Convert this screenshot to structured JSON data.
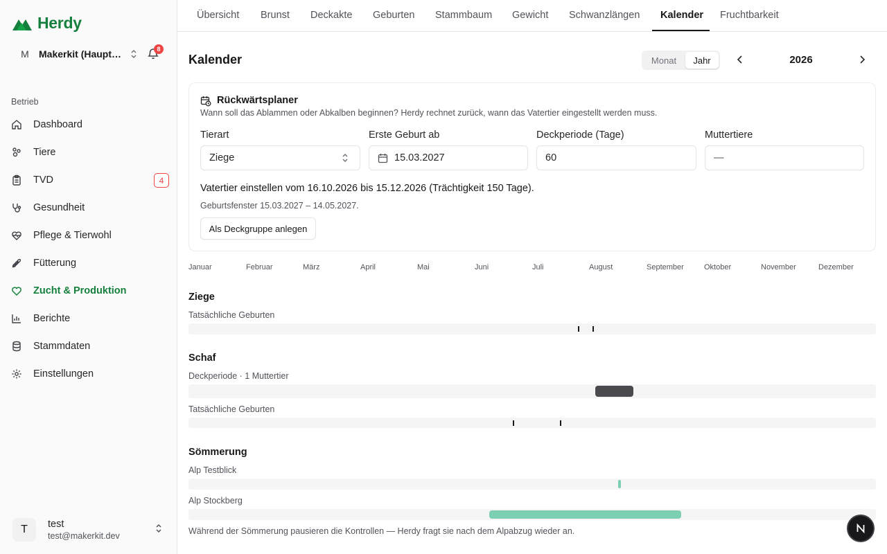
{
  "app": {
    "name": "Herdy",
    "brand_color": "#15803d"
  },
  "org": {
    "initial": "M",
    "name": "Makerkit (Hauptbetrieb)",
    "notifications": "8"
  },
  "sidebar": {
    "group_label": "Betrieb",
    "items": [
      {
        "label": "Dashboard",
        "icon": "home-icon"
      },
      {
        "label": "Tiere",
        "icon": "animal-icon"
      },
      {
        "label": "TVD",
        "icon": "clipboard-icon",
        "badge": "4"
      },
      {
        "label": "Gesundheit",
        "icon": "stethoscope-icon"
      },
      {
        "label": "Pflege & Tierwohl",
        "icon": "heart-pulse-icon"
      },
      {
        "label": "Fütterung",
        "icon": "wheat-icon"
      },
      {
        "label": "Zucht & Produktion",
        "icon": "heart-icon",
        "active": true
      },
      {
        "label": "Berichte",
        "icon": "bar-chart-icon"
      },
      {
        "label": "Stammdaten",
        "icon": "database-icon"
      },
      {
        "label": "Einstellungen",
        "icon": "gear-icon"
      }
    ]
  },
  "user": {
    "initial": "T",
    "name": "test",
    "email": "test@makerkit.dev"
  },
  "tabs": [
    "Übersicht",
    "Brunst",
    "Deckakte",
    "Geburten",
    "Stammbaum",
    "Gewicht",
    "Schwanzlängen",
    "Kalender",
    "Fruchtbarkeit"
  ],
  "active_tab": "Kalender",
  "header": {
    "title": "Kalender",
    "view_month": "Monat",
    "view_year": "Jahr",
    "active_view": "Jahr",
    "year": "2026"
  },
  "planner": {
    "title": "Rückwärtsplaner",
    "subtitle": "Wann soll das Ablammen oder Abkalben beginnen? Herdy rechnet zurück, wann das Vatertier eingestellt werden muss.",
    "fields": {
      "species_label": "Tierart",
      "species_value": "Ziege",
      "first_birth_label": "Erste Geburt ab",
      "first_birth_value": "15.03.2027",
      "period_label": "Deckperiode (Tage)",
      "period_value": "60",
      "mothers_label": "Muttertiere",
      "mothers_value": "—"
    },
    "result": "Vatertier einstellen vom 16.10.2026 bis 15.12.2026 (Trächtigkeit 150 Tage).",
    "window": "Geburtsfenster 15.03.2027 – 14.05.2027.",
    "button": "Als Deckgruppe anlegen"
  },
  "timeline": {
    "months": [
      "Januar",
      "Februar",
      "März",
      "April",
      "Mai",
      "Juni",
      "Juli",
      "August",
      "September",
      "Oktober",
      "November",
      "Dezember"
    ],
    "sections": {
      "goat": {
        "title": "Ziege",
        "births_label": "Tatsächliche Geburten",
        "births": [
          0.568,
          0.589
        ]
      },
      "sheep": {
        "title": "Schaf",
        "breeding_label": "Deckperiode · 1 Muttertier",
        "breeding": [
          0.592,
          0.647
        ],
        "births_label": "Tatsächliche Geburten",
        "births": [
          0.473,
          0.541
        ]
      },
      "summer": {
        "title": "Sömmerung",
        "pastures": [
          {
            "label": "Alp Testblick",
            "range": [
              0.625,
              0.628
            ]
          },
          {
            "label": "Alp Stockberg",
            "range": [
              0.438,
              0.717
            ]
          }
        ],
        "note": "Während der Sömmerung pausieren die Kontrollen — Herdy fragt sie nach dem Alpabzug wieder an."
      }
    },
    "colors": {
      "tick": "#18181b",
      "breeding": "#4b4b4f",
      "pasture": "#7dcfb1",
      "track": "#f5f5f6"
    }
  }
}
